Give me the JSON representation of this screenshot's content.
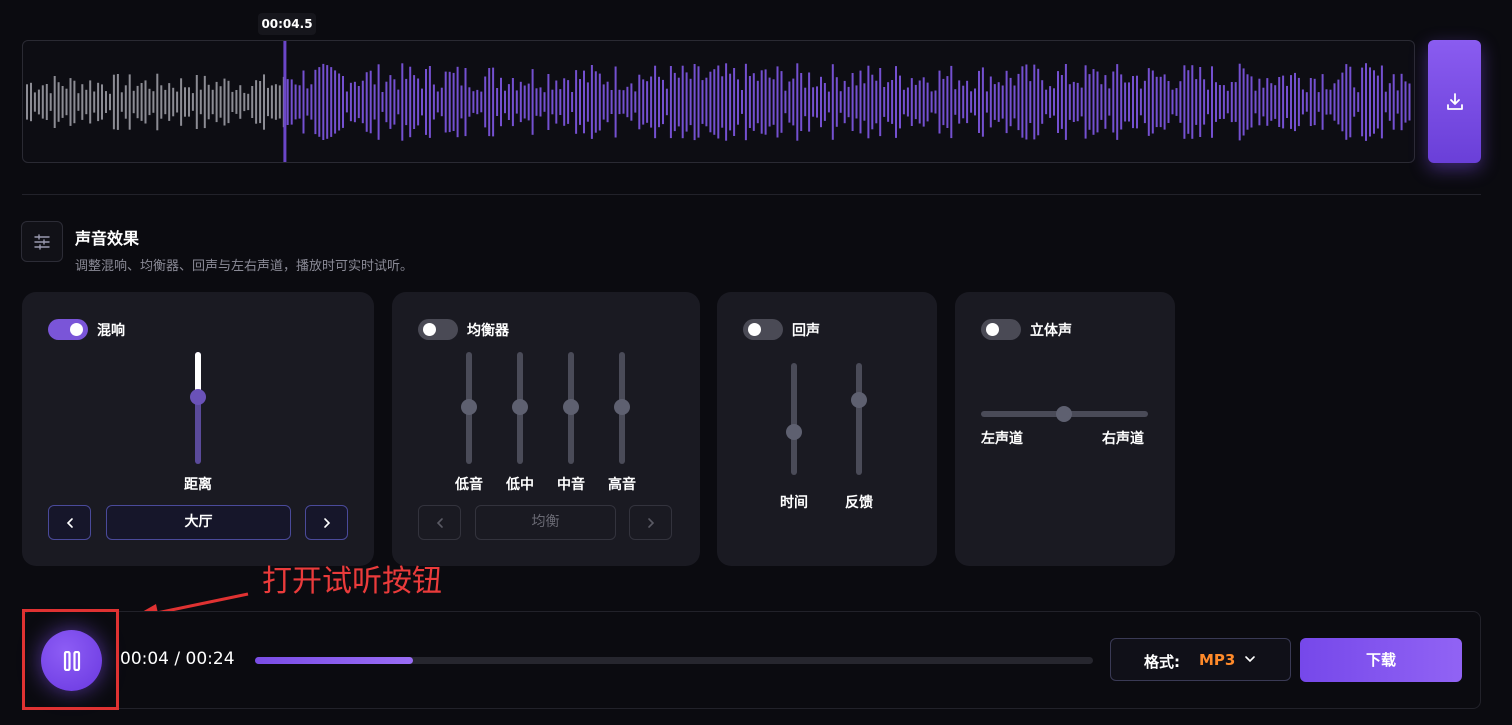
{
  "waveform": {
    "playhead_time": "00:04.5",
    "played_fraction": 0.188,
    "played_color": "#8c8c94",
    "unplayed_color": "#7450d0"
  },
  "effects": {
    "title": "声音效果",
    "subtitle": "调整混响、均衡器、回声与左右声道，播放时可实时试听。",
    "reverb": {
      "title": "混响",
      "enabled": true,
      "distance_label": "距离",
      "distance_level": 0.6,
      "preset": "大厅"
    },
    "eq": {
      "title": "均衡器",
      "enabled": false,
      "bands": [
        {
          "label": "低音",
          "level": 0.5
        },
        {
          "label": "低中",
          "level": 0.5
        },
        {
          "label": "中音",
          "level": 0.5
        },
        {
          "label": "高音",
          "level": 0.5
        }
      ],
      "preset": "均衡"
    },
    "echo": {
      "title": "回声",
      "enabled": false,
      "time_label": "时间",
      "time_level": 0.38,
      "feedback_label": "反馈",
      "feedback_level": 0.68
    },
    "stereo": {
      "title": "立体声",
      "enabled": false,
      "left_label": "左声道",
      "right_label": "右声道",
      "pan": 0.5
    }
  },
  "annotation": {
    "text": "打开试听按钮"
  },
  "player": {
    "current_time": "00:04",
    "separator": " / ",
    "total_time": "00:24",
    "progress": 0.188,
    "format_label": "格式:",
    "format_value": "MP3",
    "download_label": "下载"
  },
  "icons": {
    "download": "download-icon",
    "sliders": "sliders-icon",
    "pause": "pause-icon",
    "chevron_left": "chevron-left-icon",
    "chevron_right": "chevron-right-icon",
    "chevron_down": "chevron-down-icon"
  }
}
